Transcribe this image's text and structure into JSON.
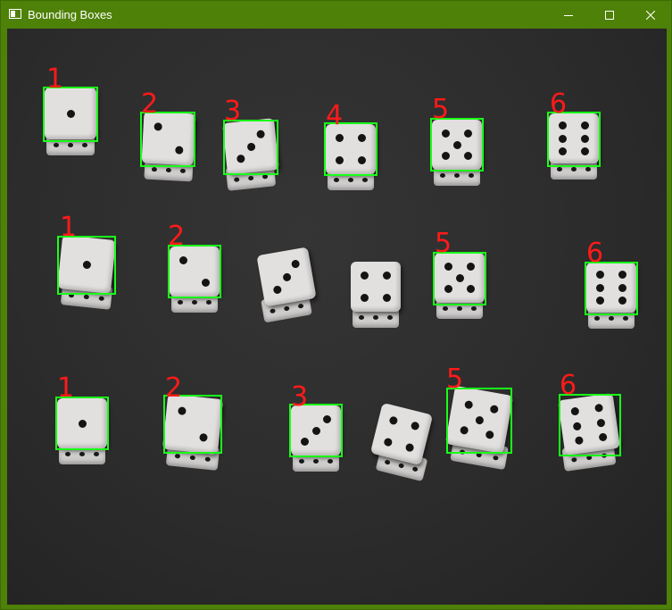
{
  "window": {
    "title": "Bounding Boxes",
    "controls": {
      "minimize": "minimize",
      "maximize": "maximize",
      "close": "close"
    }
  },
  "colors": {
    "titlebar": "#4e8107",
    "box": "#19ff19",
    "label": "#ff1a1a",
    "background": "#2f2f2f"
  },
  "detections": [
    {
      "label": "1",
      "pips": 1
    },
    {
      "label": "2",
      "pips": 2
    },
    {
      "label": "3",
      "pips": 3
    },
    {
      "label": "4",
      "pips": 4
    },
    {
      "label": "5",
      "pips": 5
    },
    {
      "label": "6",
      "pips": 6
    },
    {
      "label": "1",
      "pips": 1
    },
    {
      "label": "2",
      "pips": 2
    },
    {
      "label": "5",
      "pips": 5
    },
    {
      "label": "6",
      "pips": 6
    },
    {
      "label": "1",
      "pips": 1
    },
    {
      "label": "2",
      "pips": 2
    },
    {
      "label": "3",
      "pips": 3
    },
    {
      "label": "5",
      "pips": 5
    },
    {
      "label": "6",
      "pips": 6
    }
  ],
  "undetected_dice": [
    {
      "pips": 3
    },
    {
      "pips": 4
    },
    {
      "pips": 4
    }
  ]
}
